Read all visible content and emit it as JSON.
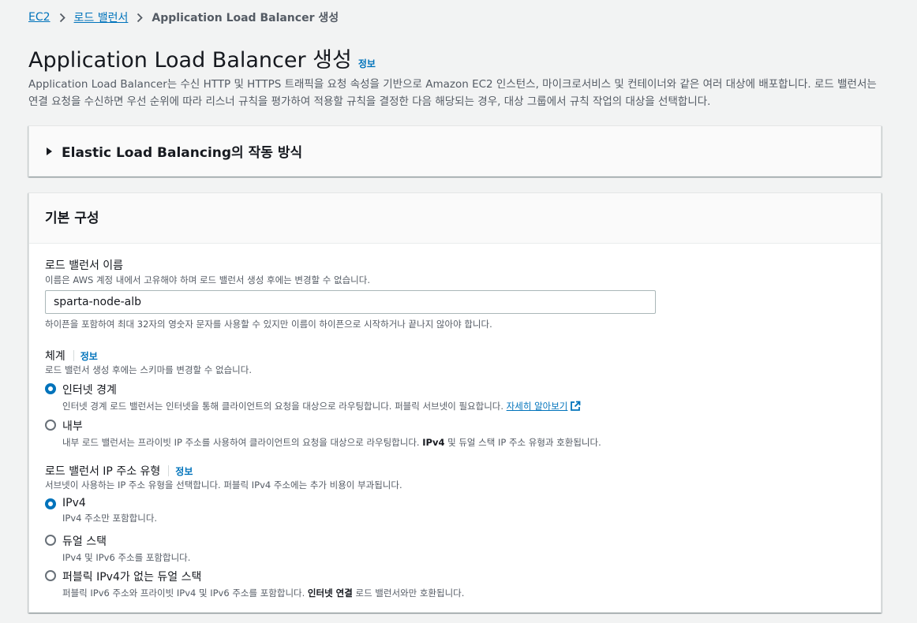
{
  "breadcrumb": {
    "ec2": "EC2",
    "load_balancers": "로드 밸런서",
    "current": "Application Load Balancer 생성"
  },
  "header": {
    "title": "Application Load Balancer 생성",
    "info": "정보",
    "description": "Application Load Balancer는 수신 HTTP 및 HTTPS 트래픽을 요청 속성을 기반으로 Amazon EC2 인스턴스, 마이크로서비스 및 컨테이너와 같은 여러 대상에 배포합니다. 로드 밸런서는 연결 요청을 수신하면 우선 순위에 따라 리스너 규칙을 평가하여 적용할 규칙을 결정한 다음 해당되는 경우, 대상 그룹에서 규칙 작업의 대상을 선택합니다."
  },
  "how_it_works": {
    "title": "Elastic Load Balancing의 작동 방식"
  },
  "basic_config": {
    "title": "기본 구성",
    "name": {
      "label": "로드 밸런서 이름",
      "description": "이름은 AWS 계정 내에서 고유해야 하며 로드 밸런서 생성 후에는 변경할 수 없습니다.",
      "value": "sparta-node-alb",
      "constraint": "하이픈을 포함하여 최대 32자의 영숫자 문자를 사용할 수 있지만 이름이 하이픈으로 시작하거나 끝나지 않아야 합니다."
    },
    "scheme": {
      "label": "체계",
      "info": "정보",
      "description": "로드 밸런서 생성 후에는 스키마를 변경할 수 없습니다.",
      "options": [
        {
          "label": "인터넷 경계",
          "desc": "인터넷 경계 로드 밸런서는 인터넷을 통해 클라이언트의 요청을 대상으로 라우팅합니다. 퍼블릭 서브넷이 필요합니다.",
          "link": "자세히 알아보기",
          "checked": true
        },
        {
          "label": "내부",
          "desc_pre": "내부 로드 밸런서는 프라이빗 IP 주소를 사용하여 클라이언트의 요청을 대상으로 라우팅합니다.",
          "desc_bold": "IPv4",
          "desc_post": "및 듀얼 스택 IP 주소 유형과 호환됩니다.",
          "checked": false
        }
      ]
    },
    "ip_type": {
      "label": "로드 밸런서 IP 주소 유형",
      "info": "정보",
      "description": "서브넷이 사용하는 IP 주소 유형을 선택합니다. 퍼블릭 IPv4 주소에는 추가 비용이 부과됩니다.",
      "options": [
        {
          "label": "IPv4",
          "desc": "IPv4 주소만 포함합니다.",
          "checked": true
        },
        {
          "label": "듀얼 스택",
          "desc": "IPv4 및 IPv6 주소를 포함합니다.",
          "checked": false
        },
        {
          "label": "퍼블릭 IPv4가 없는 듀얼 스택",
          "desc_pre": "퍼블릭 IPv6 주소와 프라이빗 IPv4 및 IPv6 주소를 포함합니다.",
          "desc_bold": "인터넷 연결",
          "desc_post": "로드 밸런서와만 호환됩니다.",
          "checked": false
        }
      ]
    }
  },
  "colors": {
    "link": "#0073bb",
    "text": "#16191f",
    "muted": "#545b64",
    "background": "#f2f3f3"
  }
}
